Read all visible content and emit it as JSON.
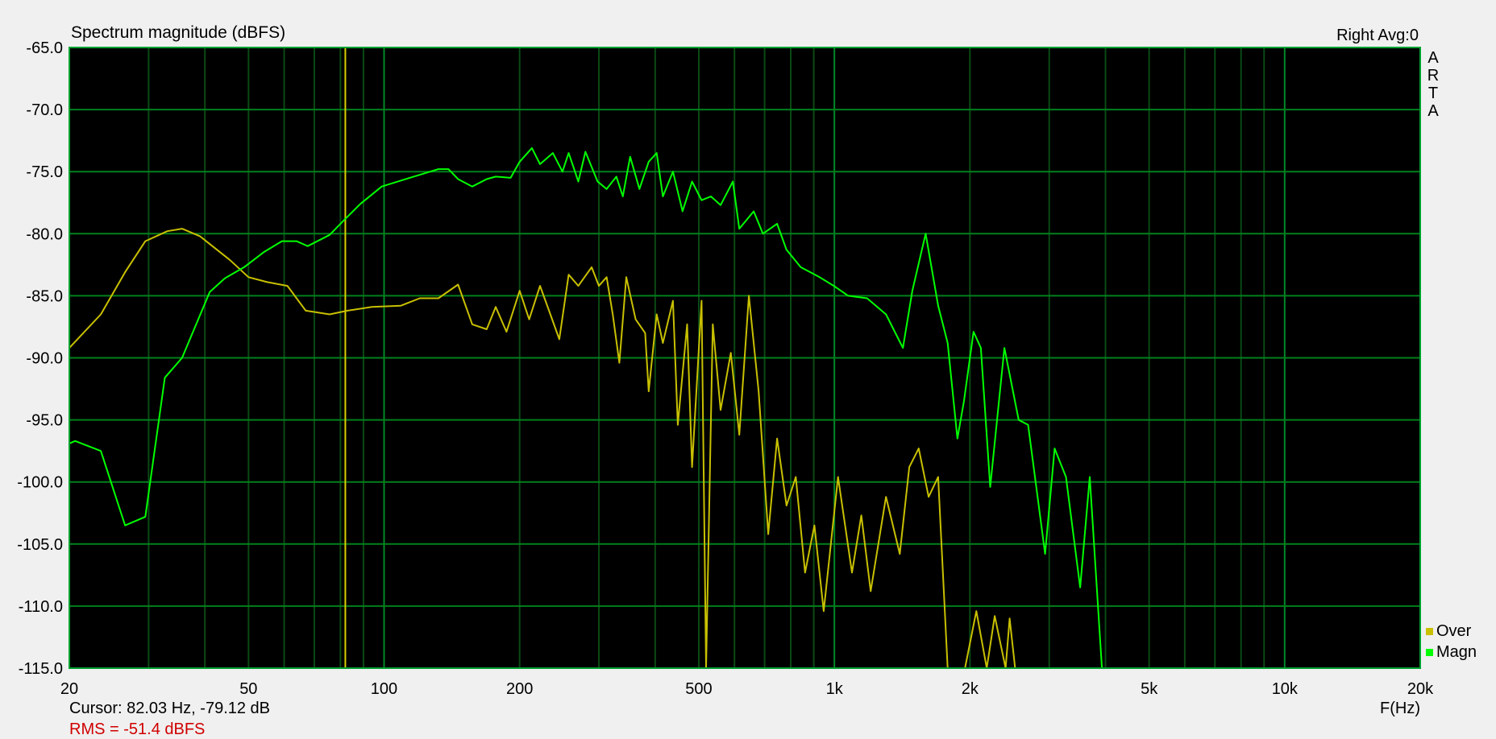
{
  "chart_data": {
    "type": "line",
    "title": "Spectrum magnitude (dBFS)",
    "channel_info": "Right  Avg:0",
    "watermark": [
      "A",
      "R",
      "T",
      "A"
    ],
    "xlabel": "F(Hz)",
    "ylabel": "",
    "xscale": "log",
    "xlim": [
      20,
      20000
    ],
    "ylim": [
      -115,
      -65
    ],
    "x_ticks": [
      20,
      50,
      100,
      200,
      500,
      1000,
      2000,
      5000,
      10000,
      20000
    ],
    "x_tick_labels": [
      "20",
      "50",
      "100",
      "200",
      "500",
      "1k",
      "2k",
      "5k",
      "10k",
      "20k"
    ],
    "y_ticks": [
      -65,
      -70,
      -75,
      -80,
      -85,
      -90,
      -95,
      -100,
      -105,
      -110,
      -115
    ],
    "y_tick_labels": [
      "-65.0",
      "-70.0",
      "-75.0",
      "-80.0",
      "-85.0",
      "-90.0",
      "-95.0",
      "-100.0",
      "-105.0",
      "-110.0",
      "-115.0"
    ],
    "grid": true,
    "legend_position": "bottom-right",
    "cursor": {
      "freq": 82.03,
      "text": "Cursor: 82.03 Hz, -79.12 dB"
    },
    "rms_text": "RMS =  -51.4 dBFS",
    "colors": {
      "background": "#000000",
      "grid_major": "#00a030",
      "grid_minor": "#0a4a14",
      "magn": "#00ff00",
      "over": "#c8c000",
      "cursor": "#d8d000",
      "rms": "#d00000"
    },
    "series": [
      {
        "name": "Over",
        "color": "#c8c000",
        "points": [
          [
            20,
            -89.2
          ],
          [
            23.5,
            -86.5
          ],
          [
            26.6,
            -83.1
          ],
          [
            29.5,
            -80.6
          ],
          [
            33,
            -79.8
          ],
          [
            35.6,
            -79.6
          ],
          [
            39,
            -80.2
          ],
          [
            45.4,
            -82.1
          ],
          [
            50,
            -83.5
          ],
          [
            55,
            -83.9
          ],
          [
            61,
            -84.2
          ],
          [
            67,
            -86.2
          ],
          [
            75.7,
            -86.5
          ],
          [
            83,
            -86.2
          ],
          [
            94,
            -85.9
          ],
          [
            109,
            -85.8
          ],
          [
            120,
            -85.2
          ],
          [
            132,
            -85.2
          ],
          [
            146,
            -84.1
          ],
          [
            157,
            -87.3
          ],
          [
            169,
            -87.7
          ],
          [
            177,
            -85.9
          ],
          [
            187,
            -87.9
          ],
          [
            200,
            -84.6
          ],
          [
            210,
            -86.9
          ],
          [
            222,
            -84.2
          ],
          [
            234,
            -86.5
          ],
          [
            245,
            -88.5
          ],
          [
            257,
            -83.3
          ],
          [
            270,
            -84.2
          ],
          [
            289,
            -82.7
          ],
          [
            300,
            -84.2
          ],
          [
            312,
            -83.5
          ],
          [
            322,
            -86.5
          ],
          [
            333,
            -90.4
          ],
          [
            345,
            -83.5
          ],
          [
            362,
            -86.9
          ],
          [
            380,
            -88
          ],
          [
            387,
            -92.7
          ],
          [
            403,
            -86.5
          ],
          [
            416,
            -88.8
          ],
          [
            438,
            -85.4
          ],
          [
            449,
            -95.4
          ],
          [
            471,
            -87.3
          ],
          [
            483,
            -98.8
          ],
          [
            507,
            -85.4
          ],
          [
            519,
            -115
          ],
          [
            537,
            -87.3
          ],
          [
            559,
            -94.2
          ],
          [
            589,
            -89.6
          ],
          [
            615,
            -96.2
          ],
          [
            646,
            -85
          ],
          [
            679,
            -92.7
          ],
          [
            713,
            -104.2
          ],
          [
            746,
            -96.5
          ],
          [
            783,
            -101.9
          ],
          [
            821,
            -99.6
          ],
          [
            861,
            -107.3
          ],
          [
            903,
            -103.5
          ],
          [
            947,
            -110.4
          ],
          [
            1019,
            -99.6
          ],
          [
            1094,
            -107.3
          ],
          [
            1148,
            -102.7
          ],
          [
            1204,
            -108.8
          ],
          [
            1302,
            -101.2
          ],
          [
            1397,
            -105.8
          ],
          [
            1467,
            -98.8
          ],
          [
            1539,
            -97.3
          ],
          [
            1619,
            -101.2
          ],
          [
            1700,
            -99.6
          ],
          [
            1785,
            -115
          ],
          [
            1950,
            -115
          ],
          [
            2067,
            -110.4
          ],
          [
            2180,
            -115
          ],
          [
            2270,
            -110.8
          ],
          [
            2400,
            -115
          ],
          [
            2450,
            -111
          ],
          [
            2520,
            -115
          ]
        ]
      },
      {
        "name": "Magn",
        "color": "#00ff00",
        "points": [
          [
            20,
            -96.9
          ],
          [
            20.6,
            -96.7
          ],
          [
            23.5,
            -97.5
          ],
          [
            26.6,
            -103.5
          ],
          [
            29.5,
            -102.8
          ],
          [
            32.6,
            -91.6
          ],
          [
            35.6,
            -90
          ],
          [
            41,
            -84.7
          ],
          [
            44.3,
            -83.6
          ],
          [
            48.9,
            -82.7
          ],
          [
            54,
            -81.5
          ],
          [
            59.3,
            -80.6
          ],
          [
            63.9,
            -80.6
          ],
          [
            67.7,
            -81
          ],
          [
            75.7,
            -80.1
          ],
          [
            81,
            -79
          ],
          [
            88.6,
            -77.6
          ],
          [
            98.8,
            -76.2
          ],
          [
            114,
            -75.5
          ],
          [
            132,
            -74.8
          ],
          [
            139,
            -74.8
          ],
          [
            146,
            -75.6
          ],
          [
            157,
            -76.2
          ],
          [
            169,
            -75.6
          ],
          [
            177,
            -75.4
          ],
          [
            191,
            -75.5
          ],
          [
            200,
            -74.2
          ],
          [
            213,
            -73.1
          ],
          [
            222,
            -74.4
          ],
          [
            237,
            -73.5
          ],
          [
            249,
            -75
          ],
          [
            257,
            -73.5
          ],
          [
            270,
            -75.8
          ],
          [
            280,
            -73.4
          ],
          [
            298,
            -75.8
          ],
          [
            312,
            -76.4
          ],
          [
            328,
            -75.4
          ],
          [
            339,
            -77
          ],
          [
            352,
            -73.8
          ],
          [
            369,
            -76.4
          ],
          [
            387,
            -74.2
          ],
          [
            403,
            -73.5
          ],
          [
            416,
            -77
          ],
          [
            438,
            -75
          ],
          [
            460,
            -78.2
          ],
          [
            483,
            -75.8
          ],
          [
            507,
            -77.3
          ],
          [
            532,
            -77
          ],
          [
            559,
            -77.7
          ],
          [
            595,
            -75.8
          ],
          [
            615,
            -79.6
          ],
          [
            662,
            -78.2
          ],
          [
            694,
            -80
          ],
          [
            746,
            -79.2
          ],
          [
            783,
            -81.3
          ],
          [
            842,
            -82.7
          ],
          [
            927,
            -83.5
          ],
          [
            997,
            -84.2
          ],
          [
            1073,
            -85
          ],
          [
            1182,
            -85.2
          ],
          [
            1302,
            -86.5
          ],
          [
            1420,
            -89.2
          ],
          [
            1490,
            -84.6
          ],
          [
            1595,
            -80
          ],
          [
            1700,
            -85.8
          ],
          [
            1785,
            -88.8
          ],
          [
            1876,
            -96.5
          ],
          [
            1940,
            -93.5
          ],
          [
            2037,
            -87.9
          ],
          [
            2115,
            -89.2
          ],
          [
            2219,
            -100.4
          ],
          [
            2386,
            -89.2
          ],
          [
            2566,
            -95
          ],
          [
            2693,
            -95.4
          ],
          [
            2938,
            -105.8
          ],
          [
            3084,
            -97.3
          ],
          [
            3269,
            -99.6
          ],
          [
            3515,
            -108.5
          ],
          [
            3691,
            -99.6
          ],
          [
            3928,
            -115
          ]
        ]
      }
    ]
  }
}
